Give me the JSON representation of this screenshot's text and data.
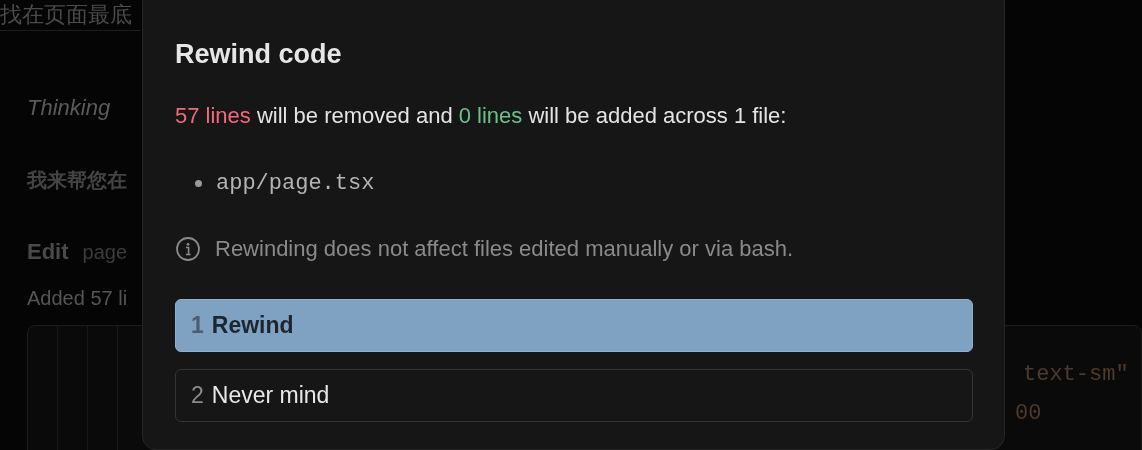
{
  "background": {
    "header_text": "找在页面最底",
    "thinking": "Thinking",
    "message": "我来帮您在",
    "edit_label": "Edit",
    "edit_file": "page",
    "edit_summary": "Added 57 li",
    "code_lines": [
      "text-sm\"",
      "00"
    ]
  },
  "dialog": {
    "title": "Rewind code",
    "summary": [
      {
        "text": "57 lines",
        "kind": "removed"
      },
      {
        "text": " will be removed and ",
        "kind": "plain"
      },
      {
        "text": "0 lines",
        "kind": "added"
      },
      {
        "text": " will be added across 1 file:",
        "kind": "plain"
      }
    ],
    "files": [
      "app/page.tsx"
    ],
    "note": "Rewinding does not affect files edited manually or via bash.",
    "options": [
      {
        "number": "1",
        "label": "Rewind",
        "selected": true
      },
      {
        "number": "2",
        "label": "Never mind",
        "selected": false
      }
    ]
  }
}
